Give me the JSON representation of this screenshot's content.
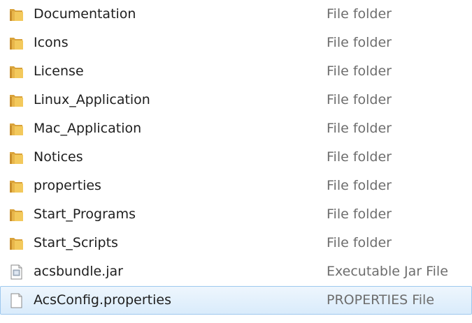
{
  "files": [
    {
      "name": "Documentation",
      "type": "File folder",
      "icon": "folder-icon"
    },
    {
      "name": "Icons",
      "type": "File folder",
      "icon": "folder-icon"
    },
    {
      "name": "License",
      "type": "File folder",
      "icon": "folder-icon"
    },
    {
      "name": "Linux_Application",
      "type": "File folder",
      "icon": "folder-icon"
    },
    {
      "name": "Mac_Application",
      "type": "File folder",
      "icon": "folder-icon"
    },
    {
      "name": "Notices",
      "type": "File folder",
      "icon": "folder-icon"
    },
    {
      "name": "properties",
      "type": "File folder",
      "icon": "folder-icon"
    },
    {
      "name": "Start_Programs",
      "type": "File folder",
      "icon": "folder-icon"
    },
    {
      "name": "Start_Scripts",
      "type": "File folder",
      "icon": "folder-icon"
    },
    {
      "name": "acsbundle.jar",
      "type": "Executable Jar File",
      "icon": "jar-file-icon"
    },
    {
      "name": "AcsConfig.properties",
      "type": "PROPERTIES File",
      "icon": "blank-file-icon",
      "selected": true
    }
  ],
  "colors": {
    "folder": "#e8b64a",
    "selection_background": "#dcecfc",
    "selection_border": "#9ec8ee",
    "type_text": "#6d6d6d"
  }
}
